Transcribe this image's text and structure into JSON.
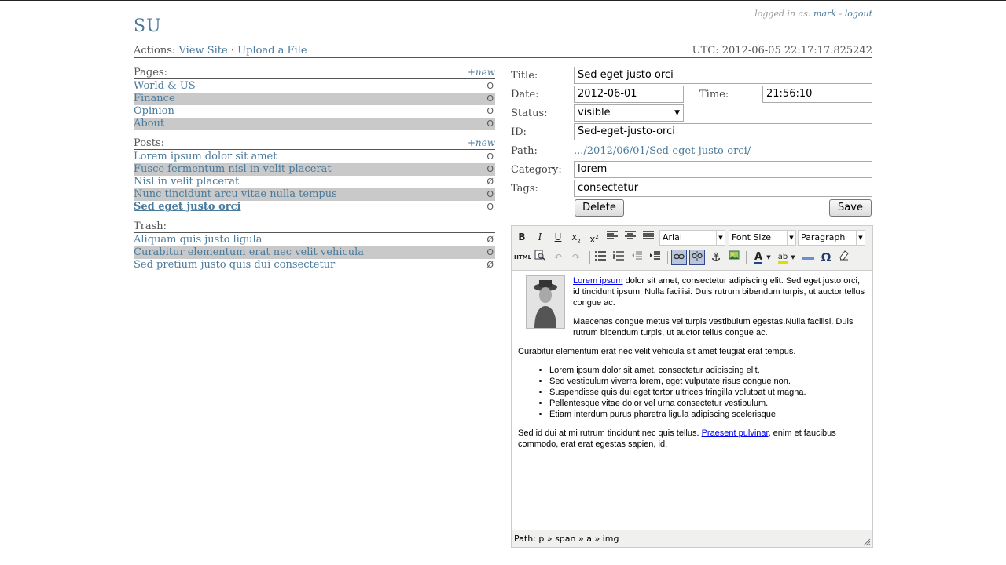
{
  "header": {
    "logged_in_label": "logged in as:",
    "username": "mark",
    "sep": "-",
    "logout": "logout",
    "logo": "SU",
    "actions_label": "Actions:",
    "view_site": "View Site",
    "dot": "·",
    "upload": "Upload a File",
    "utc": "UTC: 2012-06-05 22:17:17.825242"
  },
  "pages": {
    "title": "Pages:",
    "new": "+new",
    "items": [
      {
        "label": "World & US",
        "status": "O"
      },
      {
        "label": "Finance",
        "status": "O"
      },
      {
        "label": "Opinion",
        "status": "O"
      },
      {
        "label": "About",
        "status": "O"
      }
    ]
  },
  "posts": {
    "title": "Posts:",
    "new": "+new",
    "items": [
      {
        "label": "Lorem ipsum dolor sit amet",
        "status": "O"
      },
      {
        "label": "Fusce fermentum nisl in velit placerat",
        "status": "O"
      },
      {
        "label": "Nisl in velit placerat",
        "status": "Ø"
      },
      {
        "label": "Nunc tincidunt arcu vitae nulla tempus",
        "status": "O"
      },
      {
        "label": "Sed eget justo orci",
        "status": "O"
      }
    ]
  },
  "trash": {
    "title": "Trash:",
    "items": [
      {
        "label": "Aliquam quis justo ligula",
        "status": "Ø"
      },
      {
        "label": "Curabitur elementum erat nec velit vehicula",
        "status": "O"
      },
      {
        "label": "Sed pretium justo quis dui consectetur",
        "status": "Ø"
      }
    ]
  },
  "form": {
    "title_label": "Title:",
    "title_value": "Sed eget justo orci",
    "date_label": "Date:",
    "date_value": "2012-06-01",
    "time_label": "Time:",
    "time_value": "21:56:10",
    "status_label": "Status:",
    "status_value": "visible",
    "id_label": "ID:",
    "id_value": "Sed-eget-justo-orci",
    "path_label": "Path:",
    "path_value": ".../2012/06/01/Sed-eget-justo-orci/",
    "category_label": "Category:",
    "category_value": "lorem",
    "tags_label": "Tags:",
    "tags_value": "consectetur",
    "delete": "Delete",
    "save": "Save"
  },
  "editor": {
    "font_family": "Arial",
    "font_size": "Font Size",
    "block_format": "Paragraph",
    "html_btn": "HTML",
    "p1_link": "Lorem ipsum",
    "p1_rest": " dolor sit amet, consectetur adipiscing elit. Sed eget justo orci, id tincidunt ipsum. Nulla facilisi. Duis rutrum bibendum turpis, ut auctor tellus congue ac.",
    "p2": "Maecenas congue metus vel turpis vestibulum egestas.Nulla facilisi. Duis rutrum bibendum turpis, ut auctor tellus congue ac.",
    "p3": "Curabitur elementum erat nec velit vehicula sit amet feugiat erat tempus.",
    "bullets": [
      "Lorem ipsum dolor sit amet, consectetur adipiscing elit.",
      "Sed vestibulum viverra lorem, eget vulputate risus congue non.",
      "Suspendisse quis dui eget tortor ultrices fringilla volutpat ut magna.",
      "Pellentesque vitae dolor vel urna consectetur vestibulum.",
      "Etiam interdum purus pharetra ligula adipiscing scelerisque."
    ],
    "p4_start": "Sed id dui at mi rutrum tincidunt nec quis tellus. ",
    "p4_link": "Praesent pulvinar",
    "p4_end": ", enim et faucibus commodo, erat erat egestas sapien, id.",
    "status_path": "Path: p » span » a » img"
  }
}
